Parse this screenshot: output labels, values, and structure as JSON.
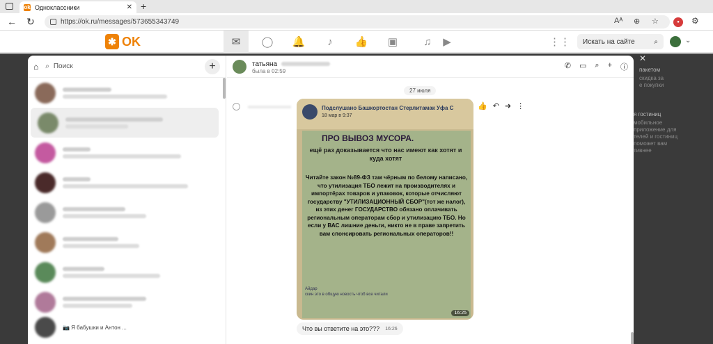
{
  "browser": {
    "tab_title": "Одноклассники",
    "url": "https://ok.ru/messages/573655343749"
  },
  "okheader": {
    "logo_text": "OK",
    "search_placeholder": "Искать на сайте"
  },
  "background": {
    "right_texts": [
      "пакетом",
      "скидка за",
      "е покупки",
      "я гостиниц",
      "мобильное",
      "приложение для",
      "телей и гостиниц",
      "поможет вам",
      "тивнее"
    ]
  },
  "messenger": {
    "search_label": "Поиск",
    "chat_last_item_preview": "📷 Я бабушки и Антон ...",
    "contact": {
      "name": "татьяна",
      "status": "была в 02:59"
    },
    "date_label": "27 июля",
    "post": {
      "source": "Подслушано Башкортостан Стерлитамак Уфа С",
      "date": "18 мар в 9:37",
      "heading": "ПРО ВЫВОЗ МУСОРА.",
      "subheading": "ещё раз доказывается что нас имеют как хотят и куда хотят",
      "body": "Читайте закон №89-ФЗ там чёрным по белому написано, что утилизация ТБО лежит на производителях и импортёрах товаров и упаковок, которые отчисляют государству \"УТИЛИЗАЦИОННЫЙ СБОР\"(тот же налог), из этих денег ГОСУДАРСТВО обязано оплачивать региональным операторам сбор и утилизацию ТБО. Но если у ВАС лишние деньги, никто не в праве запретить вам спонсировать региональных операторов!!",
      "footer": "Айдар\nскин это в общую новость чтоб все читали",
      "time": "16:25"
    },
    "reply_message": {
      "text": "Что вы ответите на это???",
      "time": "16:26"
    }
  },
  "colors": {
    "brand": "#ee8208",
    "overlay": "#3a3a3a"
  }
}
